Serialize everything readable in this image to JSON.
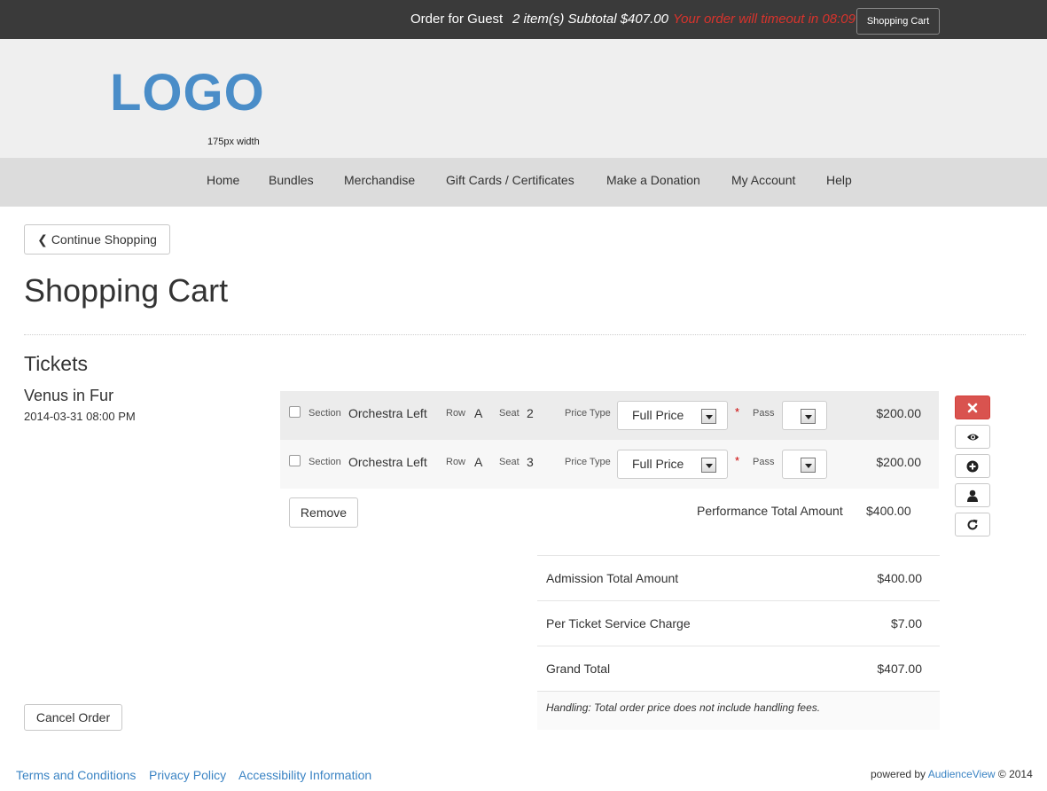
{
  "topbar": {
    "order_for": "Order for Guest",
    "items_subtotal": "2 item(s) Subtotal $407.00",
    "timeout": "Your order will timeout in 08:09",
    "cart_button": "Shopping Cart"
  },
  "header": {
    "logo": "LOGO",
    "logo_note": "175px width"
  },
  "nav": {
    "items": [
      "Home",
      "Bundles",
      "Merchandise",
      "Gift Cards / Certificates",
      "Make a Donation",
      "My Account",
      "Help"
    ]
  },
  "main": {
    "continue_label": "Continue Shopping",
    "page_title": "Shopping Cart",
    "section_title": "Tickets",
    "event": {
      "name": "Venus in Fur",
      "date": "2014-03-31 08:00 PM"
    },
    "labels": {
      "section": "Section",
      "row": "Row",
      "seat": "Seat",
      "price_type": "Price Type",
      "pass": "Pass",
      "required": "*"
    },
    "tickets": [
      {
        "section": "Orchestra Left",
        "row": "A",
        "seat": "2",
        "price_type": "Full Price",
        "pass": "",
        "price": "$200.00"
      },
      {
        "section": "Orchestra Left",
        "row": "A",
        "seat": "3",
        "price_type": "Full Price",
        "pass": "",
        "price": "$200.00"
      }
    ],
    "remove_label": "Remove",
    "performance_total_label": "Performance Total Amount",
    "performance_total_value": "$400.00",
    "totals": [
      {
        "label": "Admission Total Amount",
        "value": "$400.00"
      },
      {
        "label": "Per Ticket Service Charge",
        "value": "$7.00"
      },
      {
        "label": "Grand Total",
        "value": "$407.00"
      }
    ],
    "handling_note": "Handling:  Total order price does not include handling fees.",
    "cancel_label": "Cancel Order"
  },
  "actions": [
    "close-icon",
    "eye-icon",
    "plus-circle-icon",
    "user-icon",
    "refresh-icon"
  ],
  "footer": {
    "links": [
      "Terms and Conditions",
      "Privacy Policy",
      "Accessibility Information"
    ],
    "powered_prefix": "powered by",
    "brand": "AudienceView",
    "copyright": "© 2014"
  },
  "colors": {
    "topbar_bg": "#3a3a3a",
    "timeout_red": "#d9332c",
    "logo_blue": "#4a8dc8",
    "link_blue": "#3b84c4",
    "danger_red": "#d9534f"
  }
}
